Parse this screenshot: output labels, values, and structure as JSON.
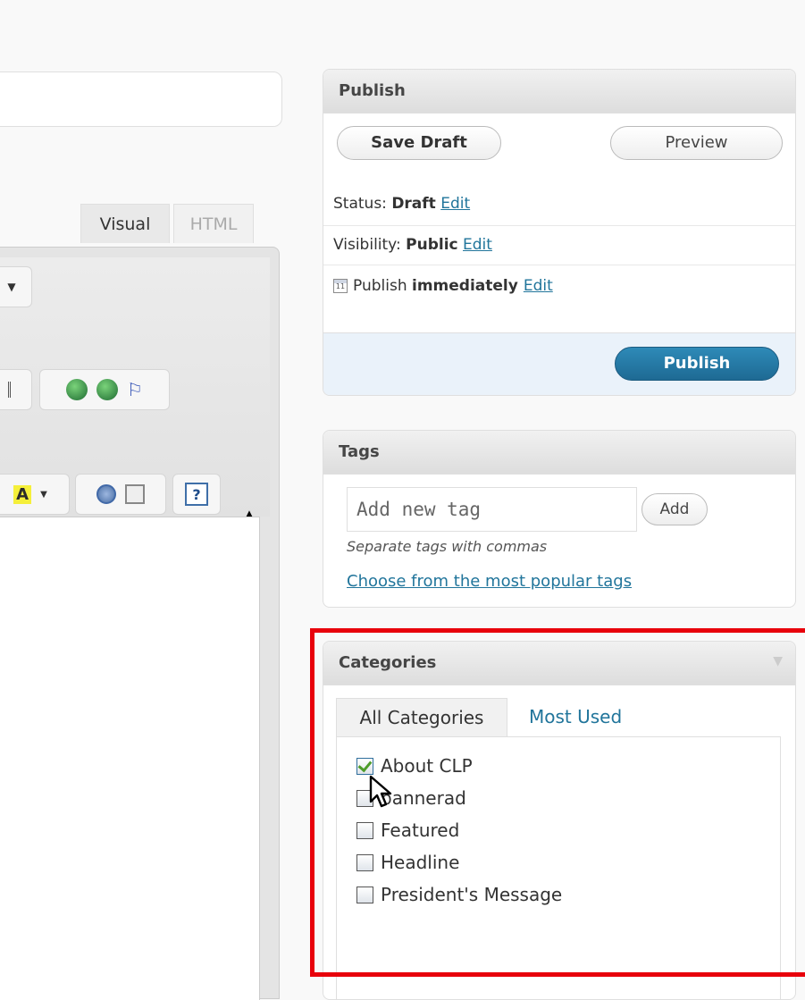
{
  "editor": {
    "tab_visual": "Visual",
    "tab_html": "HTML",
    "toolbar_icons": [
      "dropdown-arrow",
      "list-icon",
      "link-icon",
      "unlink-icon",
      "anchor-flag-icon",
      "font-color-icon",
      "media-icon",
      "search-replace-icon",
      "help-icon"
    ],
    "help_label": "?",
    "font_color_label": "A"
  },
  "publish": {
    "title": "Publish",
    "save_draft": "Save Draft",
    "preview": "Preview",
    "status_label": "Status: ",
    "status_value": "Draft",
    "visibility_label": "Visibility: ",
    "visibility_value": "Public",
    "schedule_label": "Publish ",
    "schedule_value": "immediately",
    "edit": "Edit",
    "publish_button": "Publish",
    "calendar_day": "11"
  },
  "tags": {
    "title": "Tags",
    "placeholder": "Add new tag",
    "add_button": "Add",
    "hint": "Separate tags with commas",
    "popular_link": "Choose from the most popular tags"
  },
  "categories": {
    "title": "Categories",
    "tab_all": "All Categories",
    "tab_used": "Most Used",
    "items": [
      {
        "label": "About CLP",
        "checked": true
      },
      {
        "label": "bannerad",
        "checked": false
      },
      {
        "label": "Featured",
        "checked": false
      },
      {
        "label": "Headline",
        "checked": false
      },
      {
        "label": "President's Message",
        "checked": false
      }
    ]
  },
  "colors": {
    "link": "#21759b",
    "publish_button": "#21759b",
    "highlight": "#e8000b",
    "checkmark": "#4d9c2a"
  }
}
